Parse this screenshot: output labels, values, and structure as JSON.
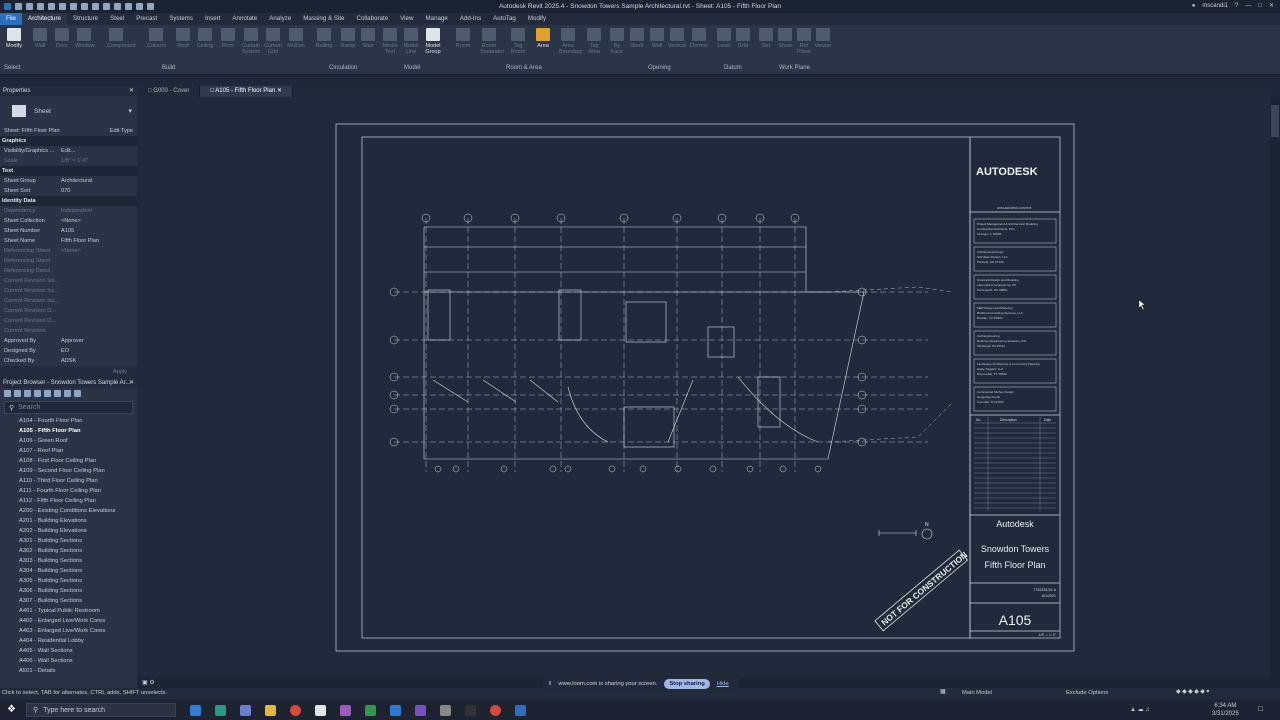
{
  "app": {
    "title": "Autodesk Revit 2025.4 - Snowdon Towers Sample Architectural.rvt - Sheet: A105 - Fifth Floor Plan",
    "user": "mscandi1"
  },
  "menu_tabs": [
    "File",
    "Architecture",
    "Structure",
    "Steel",
    "Precast",
    "Systems",
    "Insert",
    "Annotate",
    "Analyze",
    "Massing & Site",
    "Collaborate",
    "View",
    "Manage",
    "Add-Ins",
    "AutoTag",
    "Modify"
  ],
  "ribbon": {
    "buttons": [
      "Modify",
      "Wall",
      "Door",
      "Window",
      "Component",
      "Column",
      "Roof",
      "Ceiling",
      "Floor",
      "Curtain System",
      "Curtain Grid",
      "Mullion",
      "Railing",
      "Ramp",
      "Stair",
      "Model Text",
      "Model Line",
      "Model Group",
      "Room",
      "Room Separator",
      "Tag Room",
      "Area",
      "Area Boundary",
      "Tag Area",
      "By Face",
      "Shaft",
      "Wall",
      "Vertical",
      "Dormer",
      "Level",
      "Grid",
      "Set",
      "Show",
      "Ref Plane",
      "Viewer"
    ],
    "panels": [
      "Select",
      "Build",
      "Circulation",
      "Model",
      "Room & Area",
      "Opening",
      "Datum",
      "Work Plane"
    ]
  },
  "properties": {
    "header": "Properties",
    "type": "Sheet",
    "selector": "Sheet: Fifth Floor Plan",
    "edit_type": "Edit Type",
    "rows": [
      {
        "k": "Graphics",
        "v": "",
        "grp": true
      },
      {
        "k": "Visibility/Graphics ...",
        "v": "Edit...",
        "dim": false
      },
      {
        "k": "Scale",
        "v": "1/8\" = 1'-0\"",
        "dim": true
      },
      {
        "k": "Text",
        "v": "",
        "grp": true
      },
      {
        "k": "Sheet Group",
        "v": "Architectural",
        "dim": false
      },
      {
        "k": "Sheet Sort",
        "v": "070",
        "dim": false
      },
      {
        "k": "Identity Data",
        "v": "",
        "grp": true
      },
      {
        "k": "Dependency",
        "v": "Independent",
        "dim": true
      },
      {
        "k": "Sheet Collection",
        "v": "<None>",
        "dim": false
      },
      {
        "k": "Sheet Number",
        "v": "A105",
        "dim": false
      },
      {
        "k": "Sheet Name",
        "v": "Fifth Floor Plan",
        "dim": false
      },
      {
        "k": "Referencing Sheet",
        "v": "<None>",
        "dim": true
      },
      {
        "k": "Referencing Sheet",
        "v": "",
        "dim": true
      },
      {
        "k": "Referencing Detail",
        "v": "",
        "dim": true
      },
      {
        "k": "Current Revision Iss...",
        "v": "",
        "dim": true
      },
      {
        "k": "Current Revision Iss...",
        "v": "",
        "dim": true
      },
      {
        "k": "Current Revision Iss...",
        "v": "",
        "dim": true
      },
      {
        "k": "Current Revision D...",
        "v": "",
        "dim": true
      },
      {
        "k": "Current Revision D...",
        "v": "",
        "dim": true
      },
      {
        "k": "Current Revision",
        "v": "",
        "dim": true
      },
      {
        "k": "Approved By",
        "v": "Approver",
        "dim": false
      },
      {
        "k": "Designed By",
        "v": "EO",
        "dim": false
      },
      {
        "k": "Checked By",
        "v": "ADSK",
        "dim": false
      }
    ],
    "apply": "Apply"
  },
  "project_browser": {
    "header": "Project Browser - Snowdon Towers Sample Ar...",
    "search_placeholder": "Search",
    "items": [
      "A104 - Fourth Floor Plan",
      "A105 - Fifth Floor Plan",
      "A106 - Green Roof",
      "A107 - Roof Plan",
      "A108 - First Floor Ceiling Plan",
      "A109 - Second Floor Ceiling Plan",
      "A110 - Third Floor Ceiling Plan",
      "A111 - Fourth Floor Ceiling Plan",
      "A112 - Fifth Floor Ceiling Plan",
      "A200 - Existing Conditions Elevations",
      "A201 - Building Elevations",
      "A202 - Building Elevations",
      "A301 - Building Sections",
      "A302 - Building Sections",
      "A303 - Building Sections",
      "A304 - Building Sections",
      "A305 - Building Sections",
      "A306 - Building Sections",
      "A307 - Building Sections",
      "A401 - Typical Public Restroom",
      "A402 - Enlarged Live/Work Cores",
      "A403 - Enlarged Live/Work Cores",
      "A404 - Residential Lobby",
      "A405 - Wall Sections",
      "A406 - Wall Sections",
      "A501 - Details"
    ],
    "selected_index": 1
  },
  "doc_tabs": [
    {
      "label": "G000 - Cover",
      "active": false
    },
    {
      "label": "A105 - Fifth Floor Plan",
      "active": true
    }
  ],
  "sheet": {
    "logo": "AUTODESK",
    "url": "www.autodesk.com/revit",
    "client": "Autodesk",
    "project": "Snowdon Towers",
    "sheet_name": "Fifth Floor Plan",
    "sheet_number": "A105",
    "scale": "1/8\" = 1'-0\"",
    "project_number": "7765328-55-A",
    "date": "6/1/2021",
    "stamp": "NOT FOR CONSTRUCTION",
    "rev_headers": [
      "No.",
      "Description",
      "Date"
    ],
    "consultants": [
      {
        "role": "Project Management & Architectural Modeling",
        "name": "Cumberland Architects, PLC",
        "addr": "Chicago, IL 60606"
      },
      {
        "role": "Architectural Design",
        "name": "Schmitten Design, LLC",
        "addr": "Portland, OR 97209"
      },
      {
        "role": "Structural Design and Modeling",
        "name": "Lake Harbor Engineering, PC",
        "addr": "Portsmouth, NH 03801"
      },
      {
        "role": "MEP Design and Modeling",
        "name": "Bradford Consulting Services, LLC",
        "addr": "Boulder, CO 80302"
      },
      {
        "role": "Civil Engineering",
        "name": "Robinson Engineering Solutions, INC",
        "addr": "Pittsburgh, PA 15222"
      },
      {
        "role": "Landscape Architecture & Community Planning",
        "name": "Eagle Toggers, LLC",
        "addr": "Brownsville, TX 78520"
      },
      {
        "role": "Commercial Kitchen Design",
        "name": "Hedgehog Foods",
        "addr": "Knoxville, TN 37902"
      }
    ]
  },
  "status": {
    "hint": "Click to select, TAB for alternates, CTRL adds, SHIFT unselects.",
    "model": "Main Model",
    "exclude": "Exclude Options"
  },
  "loom": {
    "msg": "www.loom.com is sharing your screen.",
    "stop": "Stop sharing",
    "hide": "Hide"
  },
  "taskbar": {
    "search": "Type here to search",
    "time": "6:34 AM",
    "date": "3/31/2025"
  },
  "colors": {
    "file_tab": "#2c6fc0",
    "canvas": "#202a3a",
    "linework": "#d8dde6",
    "area_tool": "#e3a12b"
  }
}
